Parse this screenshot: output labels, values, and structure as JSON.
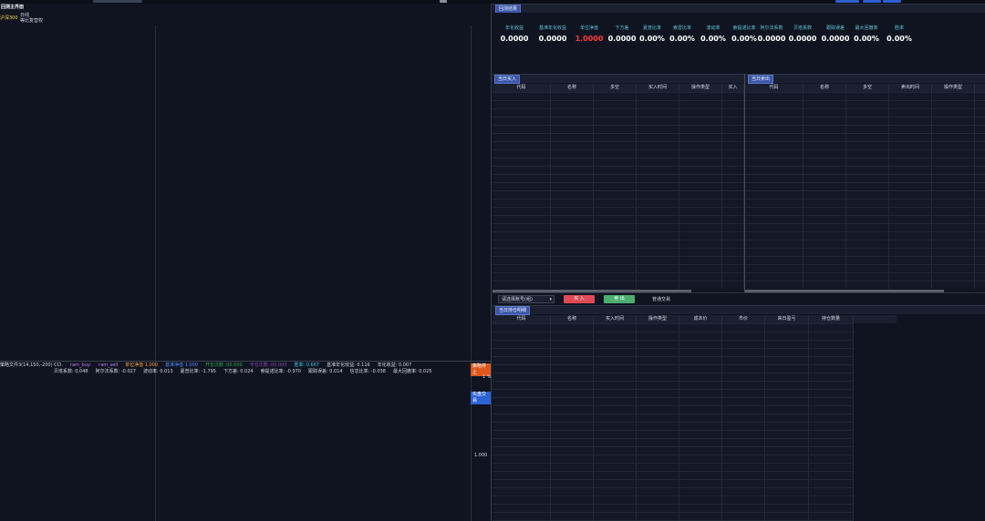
{
  "left_panel": {
    "title": "回测主界面",
    "index_name": "沪深300",
    "period": "日线",
    "compare_label": "等比复营权",
    "strategy_file": "策略文件3(14,150,-200)",
    "legend_line1": [
      {
        "text": "CCI.",
        "color": "#cfd6e4"
      },
      {
        "text": "ram_buy:",
        "color": "#c77dff"
      },
      {
        "text": "ram_sell",
        "color": "#c77dff"
      },
      {
        "text": "单位净值 1.000",
        "color": "#ff9f2e"
      },
      {
        "text": "基准净值 1.000",
        "color": "#4f8fff"
      },
      {
        "text": "开仓次数 :00.000",
        "color": "#2ea84d"
      },
      {
        "text": "平仓次数 :00.000",
        "color": "#8e44ad"
      },
      {
        "text": "胜率: 0.667",
        "color": "#38c5e8"
      },
      {
        "text": "基准年化收益: 0.116",
        "color": "#cfd6e4"
      },
      {
        "text": "年化收益: 0.007",
        "color": "#cfd6e4"
      }
    ],
    "legend_line2": [
      "贝塔系数: 0.048",
      "阿尔法系数: -0.027",
      "波动率: 0.013",
      "夏普比率: -1.795",
      "下方差: 0.024",
      "索提诺比率: -0.970",
      "跟踪误差: 0.014",
      "信息比率: -0.038",
      "最大回撤率: 0.025"
    ],
    "tag_orange": "策略停止",
    "tag_blue": "实盘交易",
    "axis_tick_small": "1 %",
    "axis_tick_value": "1.000"
  },
  "results": {
    "tab": "回测结果",
    "metrics": [
      {
        "label": "年化收益",
        "value": "0.0000",
        "color": "#ffffff"
      },
      {
        "label": "基准年化收益",
        "value": "0.0000",
        "color": "#ffffff"
      },
      {
        "label": "单位净值",
        "value": "1.0000",
        "color": "#ff3b3b"
      },
      {
        "label": "下方差",
        "value": "0.0000",
        "color": "#ffffff"
      },
      {
        "label": "夏普比率",
        "value": "0.00%",
        "color": "#ffffff"
      },
      {
        "label": "索雷比率",
        "value": "0.00%",
        "color": "#ffffff"
      },
      {
        "label": "波动率",
        "value": "0.00%",
        "color": "#ffffff"
      },
      {
        "label": "索提诺比率",
        "value": "0.00%",
        "color": "#ffffff"
      },
      {
        "label": "阿尔法系数",
        "value": "0.0000",
        "color": "#ffffff"
      },
      {
        "label": "贝塔系数",
        "value": "0.0000",
        "color": "#ffffff"
      },
      {
        "label": "跟踪误差",
        "value": "0.0000",
        "color": "#ffffff"
      },
      {
        "label": "最大回撤率",
        "value": "0.00%",
        "color": "#ffffff"
      },
      {
        "label": "胜率",
        "value": "0.00%",
        "color": "#ffffff"
      }
    ]
  },
  "buy_panel": {
    "tab": "当日买入",
    "columns": [
      "代码",
      "名称",
      "多空",
      "买入时间",
      "操作类型",
      "买入"
    ]
  },
  "sell_panel": {
    "tab": "当日卖出",
    "columns": [
      "代码",
      "名称",
      "多空",
      "卖出时间",
      "操作类型"
    ]
  },
  "controls": {
    "account_select": "请选择账号(组)",
    "buy_button": "买 入",
    "sell_button": "卖 出",
    "trade_mode": "普通交易"
  },
  "position_panel": {
    "tab": "当日持仓明细",
    "columns": [
      "代码",
      "名称",
      "买入时间",
      "操作类型",
      "成本价",
      "市价",
      "来日盈亏",
      "持仓数量"
    ]
  },
  "colors": {
    "accent": "#3d57a8",
    "buy_red": "#e04a55",
    "sell_green": "#4caf70",
    "metric_label": "#5ec2d8"
  }
}
